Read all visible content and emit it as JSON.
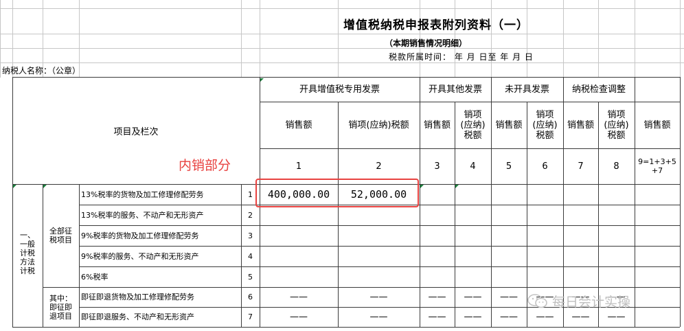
{
  "header": {
    "title": "增值税纳税申报表附列资料（一）",
    "subtitle": "（本期销售情况明细）",
    "period": "税款所属时间：  年  月 日至  年  月  日",
    "taxpayer": "纳税人名称：（公章）"
  },
  "columns": {
    "item_header": "项目及栏次",
    "annotation": "内销部分",
    "groups": [
      "开具增值税专用发票",
      "开具其他发票",
      "未开具发票",
      "纳税检查调整"
    ],
    "sales": "销售额",
    "output_tax_wide": "销项(应纳)税额",
    "output_tax": "销项\n(应纳)\n税额",
    "numbers": [
      "1",
      "2",
      "3",
      "4",
      "5",
      "6",
      "7",
      "8",
      "9=1+3+5\n+7"
    ]
  },
  "sections": {
    "general_method": "一、\n一般\n计税\n方法\n计税",
    "all_items": "全部征\n税项目",
    "of_which": "其中：\n即征即\n退项目"
  },
  "rows": [
    {
      "label": "13%税率的货物及加工修理修配劳务",
      "no": "1",
      "sales": "400,000.00",
      "tax": "52,000.00",
      "dash": false
    },
    {
      "label": "13%税率的服务、不动产和无形资产",
      "no": "2",
      "sales": "",
      "tax": "",
      "dash": false
    },
    {
      "label": "9%税率的货物及加工修理修配劳务",
      "no": "3",
      "sales": "",
      "tax": "",
      "dash": false
    },
    {
      "label": "9%税率的服务、不动产和无形资产",
      "no": "4",
      "sales": "",
      "tax": "",
      "dash": false
    },
    {
      "label": "6%税率",
      "no": "5",
      "sales": "",
      "tax": "",
      "dash": false
    },
    {
      "label": "即征即退货物及加工修理修配劳务",
      "no": "6",
      "sales": "",
      "tax": "",
      "dash": true
    },
    {
      "label": "即征即退服务、不动产和无形资产",
      "no": "7",
      "sales": "",
      "tax": "",
      "dash": true
    }
  ],
  "dash_text": "——",
  "watermark": "每日会计实操",
  "colors": {
    "annotation": "#e8413f",
    "grid": "#c6c6c6",
    "border": "#3a3a3a"
  }
}
